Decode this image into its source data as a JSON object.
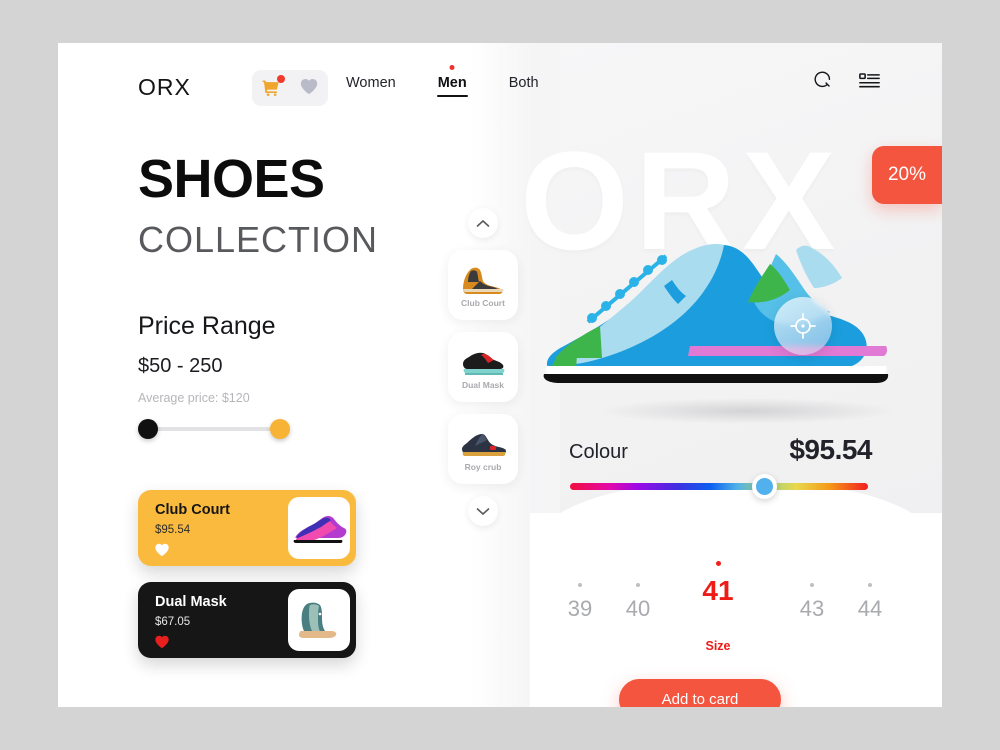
{
  "brand": "ORX",
  "watermark": "ORX",
  "header": {
    "cart_icon": "shopping-cart-icon",
    "wishlist_icon": "heart-icon",
    "search_icon": "search-icon",
    "menu_icon": "list-menu-icon",
    "nav": [
      {
        "label": "Women",
        "active": false
      },
      {
        "label": "Men",
        "active": true
      },
      {
        "label": "Both",
        "active": false
      }
    ]
  },
  "hero": {
    "title": "SHOES",
    "subtitle": "COLLECTION",
    "badge": "20%",
    "hotspot_icon": "crosshair-target-icon"
  },
  "filter": {
    "title": "Price Range",
    "range": "$50 - 250",
    "average": "Average price: $120",
    "min_color": "#101010",
    "max_color": "#f7b335"
  },
  "products": [
    {
      "name": "Club Court",
      "price": "$95.54",
      "bg": "#f9ba3e",
      "favorited": false,
      "heart_icon": "heart-outline-icon"
    },
    {
      "name": "Dual Mask",
      "price": "$67.05",
      "bg": "#161616",
      "favorited": true,
      "heart_icon": "heart-filled-icon"
    }
  ],
  "rail": {
    "up_icon": "chevron-up-icon",
    "down_icon": "chevron-down-icon",
    "items": [
      {
        "label": "Club Court"
      },
      {
        "label": "Dual Mask"
      },
      {
        "label": "Roy crub"
      }
    ]
  },
  "detail": {
    "colour_label": "Colour",
    "price": "$95.54",
    "size_caption": "Size",
    "add_button": "Add to card",
    "accent": "#f4553f",
    "sizes": [
      {
        "value": "39",
        "selected": false
      },
      {
        "value": "40",
        "selected": false
      },
      {
        "value": "41",
        "selected": true
      },
      {
        "value": "43",
        "selected": false
      },
      {
        "value": "44",
        "selected": false
      }
    ]
  }
}
